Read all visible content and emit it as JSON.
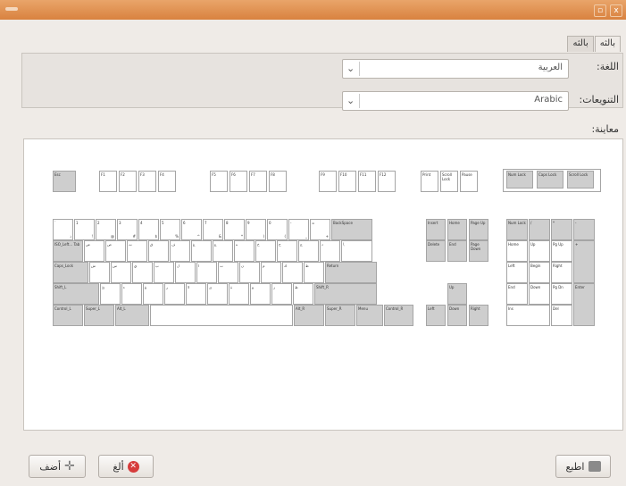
{
  "titlebar": {
    "close_glyph": "x",
    "maximize_glyph": "▫"
  },
  "tabs": [
    {
      "label": "بالثه",
      "active": true
    },
    {
      "label": "بالثه",
      "active": false
    }
  ],
  "fields": {
    "language": {
      "label": "اللغة:",
      "value": "العربية"
    },
    "variants": {
      "label": "التنويعات:",
      "value": "Arabic"
    }
  },
  "preview_label": "معاينة:",
  "keyboard": {
    "fkeys": [
      "Esc",
      "F1",
      "F2",
      "F3",
      "F4",
      "F5",
      "F6",
      "F7",
      "F8",
      "F9",
      "F10",
      "F11",
      "F12"
    ],
    "sys": [
      "Print",
      "Scroll Lock",
      "Pause"
    ],
    "locks": [
      "Num Lock",
      "Caps Lock",
      "Scroll Lock"
    ],
    "row1": [
      [
        "`",
        "ذ"
      ],
      [
        "1",
        "!"
      ],
      [
        "2",
        "@"
      ],
      [
        "3",
        "#"
      ],
      [
        "4",
        "$"
      ],
      [
        "5",
        "%"
      ],
      [
        "6",
        "^"
      ],
      [
        "7",
        "&"
      ],
      [
        "8",
        "*"
      ],
      [
        "9",
        ")"
      ],
      [
        "0",
        "("
      ],
      [
        "-",
        "_"
      ],
      [
        "=",
        "+"
      ]
    ],
    "backspace": "BackSpace",
    "tab": "ISO_Left... Tab",
    "row2": [
      [
        "ض",
        ""
      ],
      [
        "ص",
        ""
      ],
      [
        "ث",
        ""
      ],
      [
        "ق",
        ""
      ],
      [
        "ف",
        ""
      ],
      [
        "غ",
        ""
      ],
      [
        "ع",
        ""
      ],
      [
        "ه",
        ""
      ],
      [
        "خ",
        ""
      ],
      [
        "ح",
        ""
      ],
      [
        "ج",
        ""
      ],
      [
        "د",
        ""
      ]
    ],
    "backslash": "\\",
    "caps": "Caps_Lock",
    "row3": [
      [
        "ش",
        ""
      ],
      [
        "س",
        ""
      ],
      [
        "ي",
        ""
      ],
      [
        "ب",
        ""
      ],
      [
        "ل",
        ""
      ],
      [
        "ا",
        ""
      ],
      [
        "ت",
        ""
      ],
      [
        "ن",
        ""
      ],
      [
        "م",
        ""
      ],
      [
        "ك",
        ""
      ],
      [
        "ط",
        ""
      ]
    ],
    "enter": "Return",
    "shift_l": "Shift_L",
    "row4": [
      [
        "ئ",
        ""
      ],
      [
        "ء",
        ""
      ],
      [
        "ؤ",
        ""
      ],
      [
        "ر",
        ""
      ],
      [
        "لا",
        ""
      ],
      [
        "ى",
        ""
      ],
      [
        "ة",
        ""
      ],
      [
        "و",
        ""
      ],
      [
        "ز",
        ""
      ],
      [
        "ظ",
        ""
      ]
    ],
    "shift_r": "Shift_R",
    "bottom": [
      "Control_L",
      "Super_L",
      "Alt_L",
      "Alt_R",
      "Super_R",
      "Menu",
      "Control_R"
    ],
    "nav_top": [
      "Insert",
      "Home",
      "Page Up",
      "Delete",
      "End",
      "Page Down"
    ],
    "arrows": [
      "Up",
      "Left",
      "Down",
      "Right"
    ],
    "numpad": [
      "Num Lock",
      "/",
      "*",
      "-",
      "Home",
      "Up",
      "Pg Up",
      "+",
      "Left",
      "Begin",
      "Right",
      "End",
      "Down",
      "Pg Dn",
      "Enter",
      "Ins",
      "Del"
    ]
  },
  "buttons": {
    "add": "أضف",
    "cancel": "ألغ",
    "print": "اطبع"
  }
}
